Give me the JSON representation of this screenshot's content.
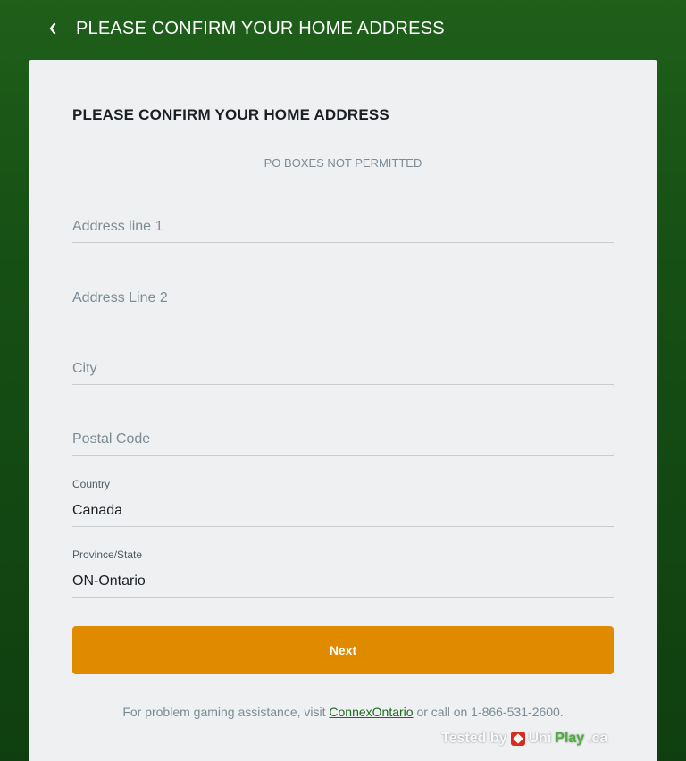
{
  "header": {
    "title": "PLEASE CONFIRM YOUR HOME ADDRESS",
    "back_icon": "chevron-left-icon"
  },
  "form": {
    "title": "PLEASE CONFIRM YOUR HOME ADDRESS",
    "notice": "PO BOXES NOT PERMITTED",
    "address1": {
      "placeholder": "Address line 1",
      "value": ""
    },
    "address2": {
      "placeholder": "Address Line 2",
      "value": ""
    },
    "city": {
      "placeholder": "City",
      "value": ""
    },
    "postal": {
      "placeholder": "Postal Code",
      "value": ""
    },
    "country": {
      "label": "Country",
      "value": "Canada"
    },
    "province": {
      "label": "Province/State",
      "value": "ON-Ontario"
    },
    "next_label": "Next"
  },
  "footer": {
    "prefix": "For problem gaming assistance, visit ",
    "link": "ConnexOntario",
    "suffix": " or call on 1-866-531-2600."
  },
  "watermark": {
    "tested_by": "Tested by",
    "brand_a": "Uni",
    "brand_b": "Play",
    "brand_c": ".ca"
  },
  "colors": {
    "accent": "#e08a00",
    "background": "#1f5f1a",
    "card": "#eef0f2",
    "link": "#1e6b1e"
  }
}
